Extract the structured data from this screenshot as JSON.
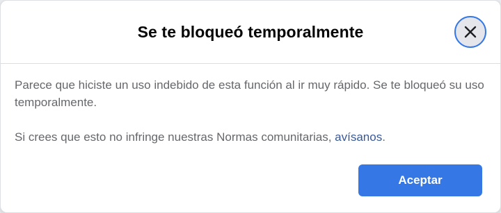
{
  "dialog": {
    "title": "Se te bloqueó temporalmente",
    "close_icon": "close-icon",
    "paragraph1": "Parece que hiciste un uso indebido de esta función al ir muy rápido. Se te bloqueó su uso temporalmente.",
    "paragraph2_text": "Si crees que esto no infringe nuestras Normas comunitarias, ",
    "paragraph2_link": "avísanos",
    "paragraph2_end": ".",
    "accept_label": "Aceptar"
  },
  "colors": {
    "accent": "#3578e5",
    "link": "#385898",
    "body_text": "#65676b",
    "title_text": "#050505"
  }
}
